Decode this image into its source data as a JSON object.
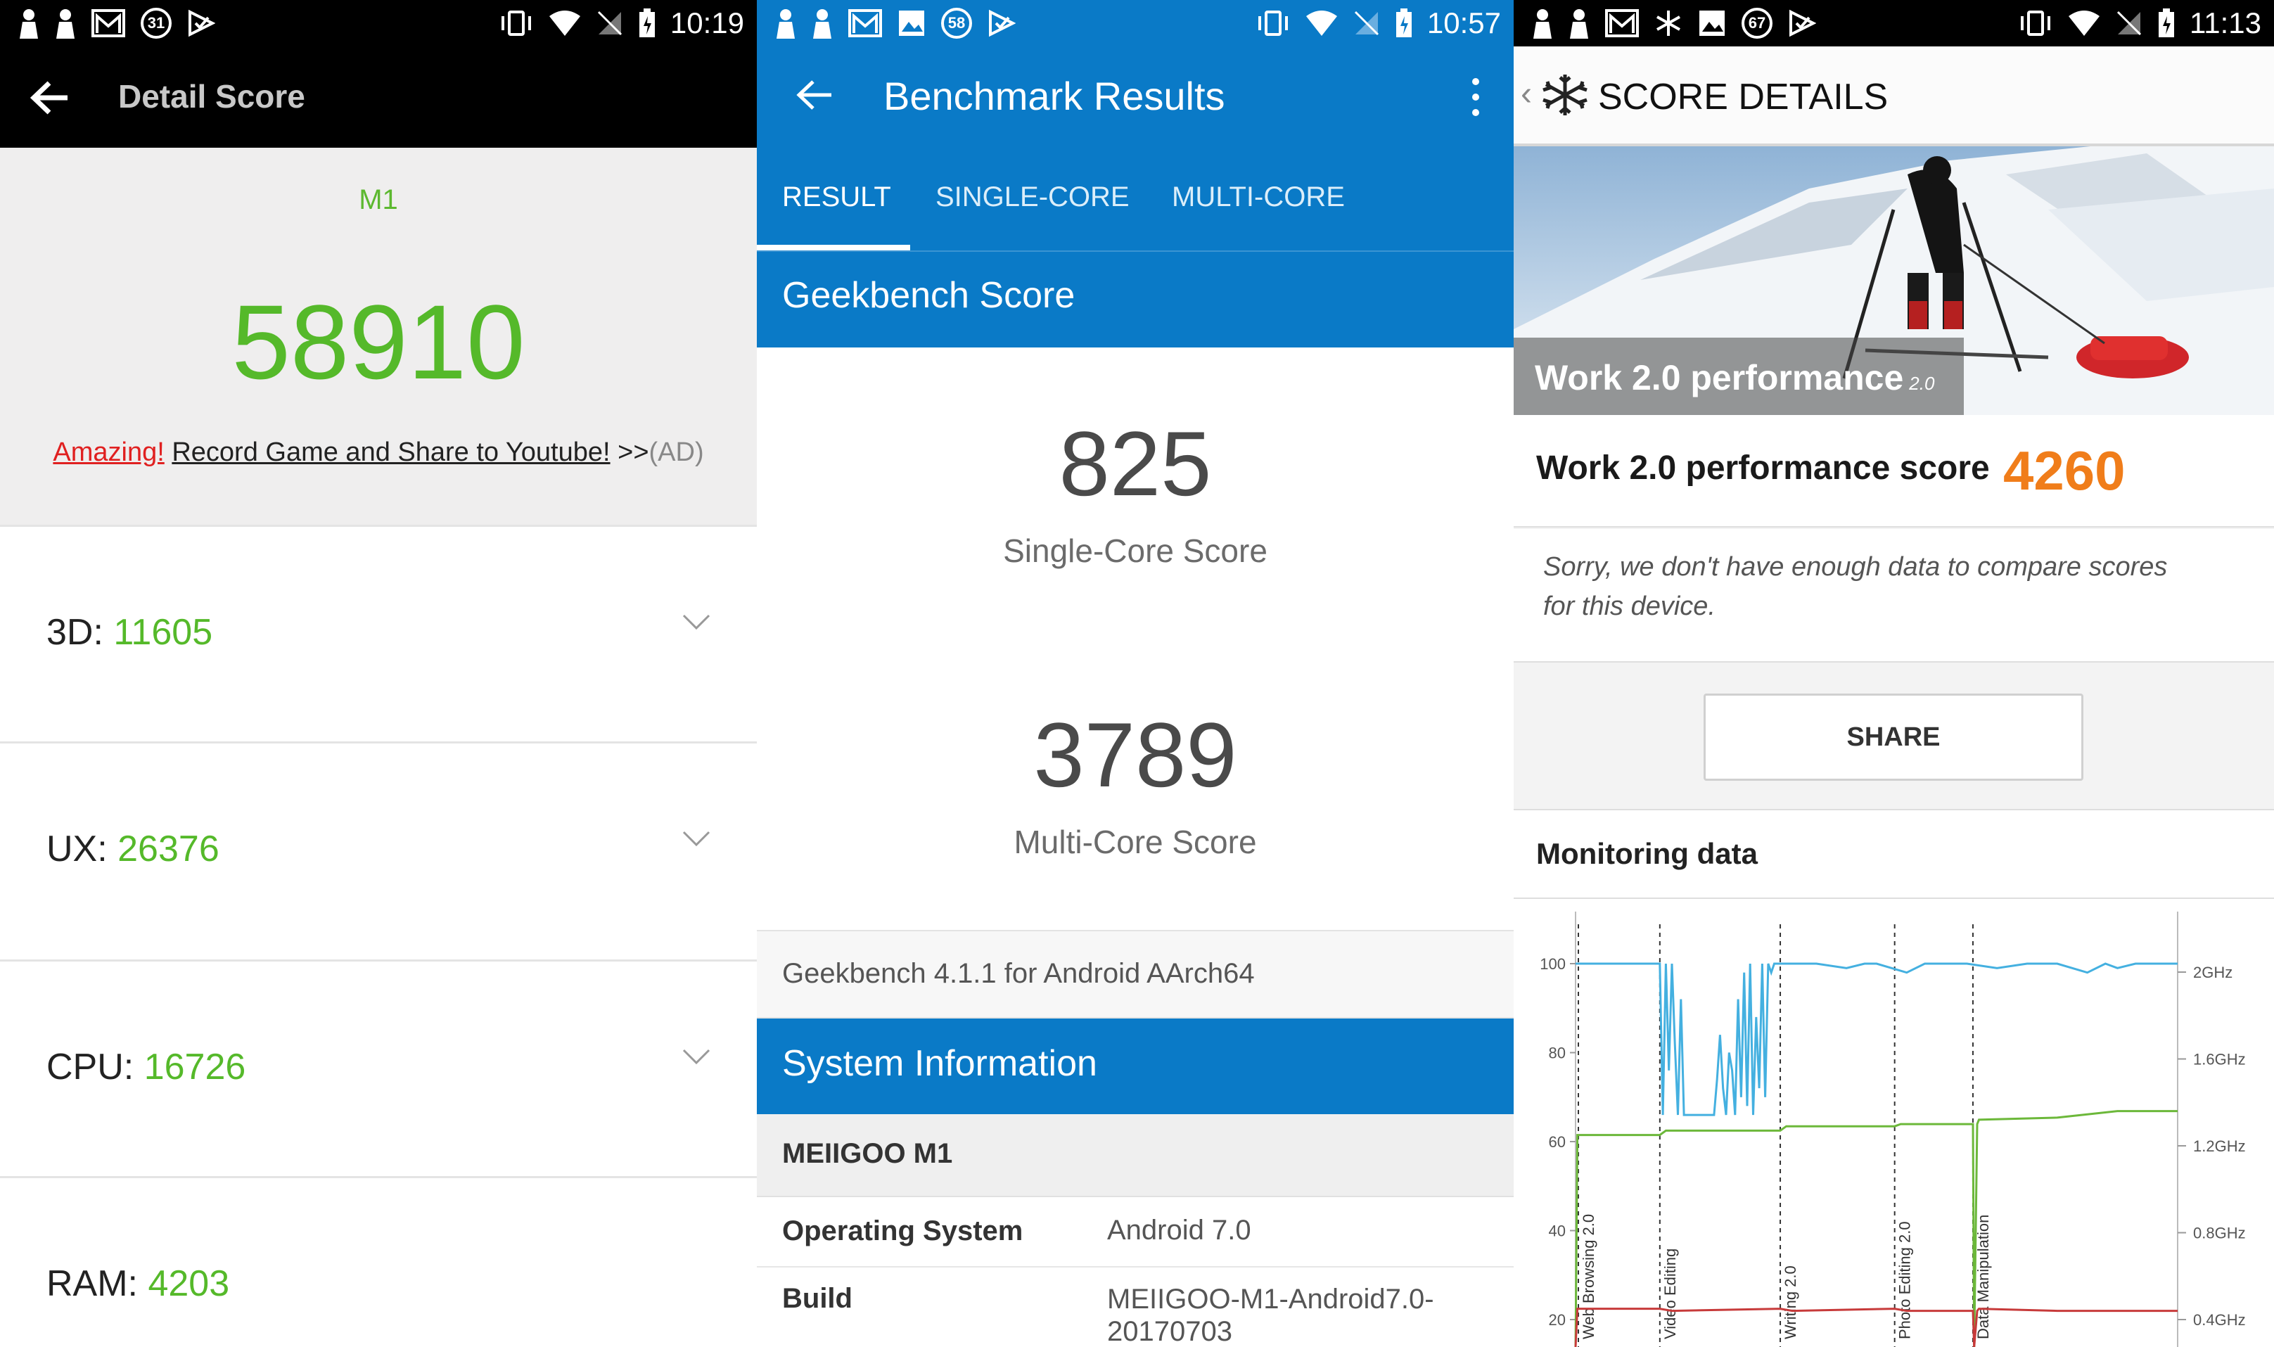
{
  "panel1": {
    "status": {
      "time": "10:19",
      "badge": "31"
    },
    "title": "Detail Score",
    "model": "M1",
    "score": "58910",
    "ad": {
      "amazing": "Amazing!",
      "text": "Record Game and Share to Youtube!",
      "arrows": ">>",
      "tag": "(AD)"
    },
    "rows": [
      {
        "label": "3D:",
        "value": "11605"
      },
      {
        "label": "UX:",
        "value": "26376"
      },
      {
        "label": "CPU:",
        "value": "16726"
      },
      {
        "label": "RAM:",
        "value": "4203"
      }
    ]
  },
  "panel2": {
    "status": {
      "time": "10:57",
      "badge": "58"
    },
    "title": "Benchmark Results",
    "tabs": [
      "RESULT",
      "SINGLE-CORE",
      "MULTI-CORE"
    ],
    "section_title": "Geekbench Score",
    "single_score": "825",
    "single_label": "Single-Core Score",
    "multi_score": "3789",
    "multi_label": "Multi-Core Score",
    "version": "Geekbench 4.1.1 for Android AArch64",
    "system_title": "System Information",
    "device": "MEIIGOO M1",
    "info": [
      {
        "key": "Operating System",
        "value": "Android 7.0"
      },
      {
        "key": "Build",
        "value": "MEIIGOO-M1-Android7.0-",
        "value2": "20170703"
      }
    ]
  },
  "panel3": {
    "status": {
      "time": "11:13",
      "badge": "67"
    },
    "title": "SCORE DETAILS",
    "hero_label": "Work 2.0 performance",
    "hero_version": "2.0",
    "score_label": "Work 2.0 performance score",
    "score": "4260",
    "sorry_line1": "Sorry, we don't have enough data to compare scores",
    "sorry_line2": "for this device.",
    "share": "SHARE",
    "monitoring": "Monitoring data",
    "chart_data": {
      "type": "line",
      "y_left_ticks": [
        "100",
        "80",
        "60",
        "40",
        "20"
      ],
      "y_right_ticks": [
        "2GHz",
        "1.6GHz",
        "1.2GHz",
        "0.8GHz",
        "0.4GHz"
      ],
      "y_left_range": [
        0,
        100
      ],
      "y_right_range_ghz": [
        0,
        2.2
      ],
      "segments": [
        "Web Browsing 2.0",
        "Video Editing",
        "Writing 2.0",
        "Photo Editing 2.0",
        "Data Manipulation"
      ],
      "segment_starts": [
        0.0,
        0.14,
        0.34,
        0.53,
        0.66
      ],
      "series": [
        {
          "name": "",
          "axis": "left",
          "color": "#44b0e0",
          "x": [
            0,
            0.14,
            0.145,
            0.15,
            0.155,
            0.16,
            0.165,
            0.17,
            0.175,
            0.18,
            0.19,
            0.2,
            0.21,
            0.22,
            0.23,
            0.235,
            0.24,
            0.245,
            0.25,
            0.255,
            0.26,
            0.265,
            0.27,
            0.275,
            0.28,
            0.285,
            0.29,
            0.295,
            0.3,
            0.305,
            0.31,
            0.315,
            0.32,
            0.325,
            0.33,
            0.335,
            0.34,
            0.4,
            0.45,
            0.48,
            0.5,
            0.55,
            0.58,
            0.62,
            0.65,
            0.7,
            0.75,
            0.8,
            0.85,
            0.88,
            0.9,
            0.93,
            0.95,
            1.0
          ],
          "y": [
            100,
            100,
            66,
            100,
            76,
            100,
            82,
            66,
            92,
            66,
            66,
            66,
            66,
            66,
            66,
            74,
            84,
            72,
            66,
            80,
            76,
            66,
            92,
            70,
            98,
            68,
            100,
            66,
            88,
            72,
            100,
            70,
            100,
            98,
            100,
            100,
            100,
            100,
            99,
            100,
            100,
            98,
            100,
            100,
            100,
            99,
            100,
            100,
            98,
            100,
            99,
            100,
            100,
            100
          ]
        },
        {
          "name": "",
          "axis": "right",
          "color": "#6cb83a",
          "x": [
            0,
            0.003,
            0.006,
            0.14,
            0.15,
            0.34,
            0.35,
            0.53,
            0.54,
            0.66,
            0.662,
            0.667,
            0.67,
            0.8,
            0.9,
            1.0
          ],
          "y": [
            0,
            1.25,
            1.25,
            1.25,
            1.27,
            1.27,
            1.29,
            1.29,
            1.3,
            1.3,
            0,
            1.3,
            1.32,
            1.33,
            1.36,
            1.36
          ]
        },
        {
          "name": "",
          "axis": "right",
          "color": "#c73a3a",
          "x": [
            0,
            0.003,
            0.006,
            0.14,
            0.16,
            0.34,
            0.36,
            0.53,
            0.55,
            0.66,
            0.662,
            0.667,
            0.67,
            0.8,
            0.9,
            1.0
          ],
          "y": [
            0,
            0.45,
            0.45,
            0.45,
            0.44,
            0.45,
            0.44,
            0.45,
            0.44,
            0.44,
            0,
            0.44,
            0.45,
            0.44,
            0.44,
            0.44
          ]
        }
      ]
    }
  }
}
